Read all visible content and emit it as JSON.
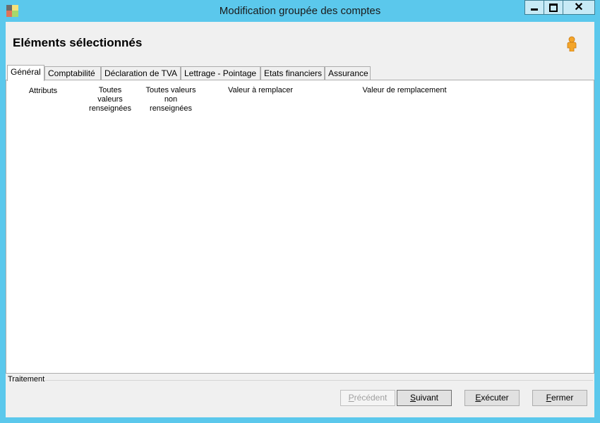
{
  "window": {
    "title": "Modification groupée des comptes",
    "minimize_icon": "minimize-icon",
    "maximize_icon": "maximize-icon",
    "close_icon": "close-icon",
    "colors": {
      "frame": "#5bc8ec",
      "client": "#f0f0f0"
    }
  },
  "header": {
    "title": "Eléments sélectionnés",
    "user_icon": "user-icon"
  },
  "tabs": [
    {
      "label": "Général",
      "active": true
    },
    {
      "label": "Comptabilité",
      "active": false
    },
    {
      "label": "Déclaration de TVA",
      "active": false
    },
    {
      "label": "Lettrage - Pointage",
      "active": false
    },
    {
      "label": "Etats financiers",
      "active": false
    },
    {
      "label": "Assurance",
      "active": false
    }
  ],
  "columns": {
    "attributs": "Attributs",
    "toutes_renseignees_1": "Toutes",
    "toutes_renseignees_2": "valeurs",
    "toutes_renseignees_3": "renseignées",
    "toutes_non_1": "Toutes valeurs",
    "toutes_non_2": "non",
    "toutes_non_3": "renseignées",
    "valeur_a_remplacer": "Valeur à remplacer",
    "valeur_de_remplacement": "Valeur de remplacement"
  },
  "footer": {
    "group_label": "Traitement",
    "buttons": {
      "precedent": {
        "first": "P",
        "rest": "récédent",
        "enabled": false
      },
      "suivant": {
        "first": "S",
        "rest": "uivant",
        "enabled": true
      },
      "executer": {
        "first": "E",
        "rest": "xécuter",
        "enabled": true
      },
      "fermer": {
        "first": "F",
        "rest": "ermer",
        "enabled": true
      }
    }
  }
}
